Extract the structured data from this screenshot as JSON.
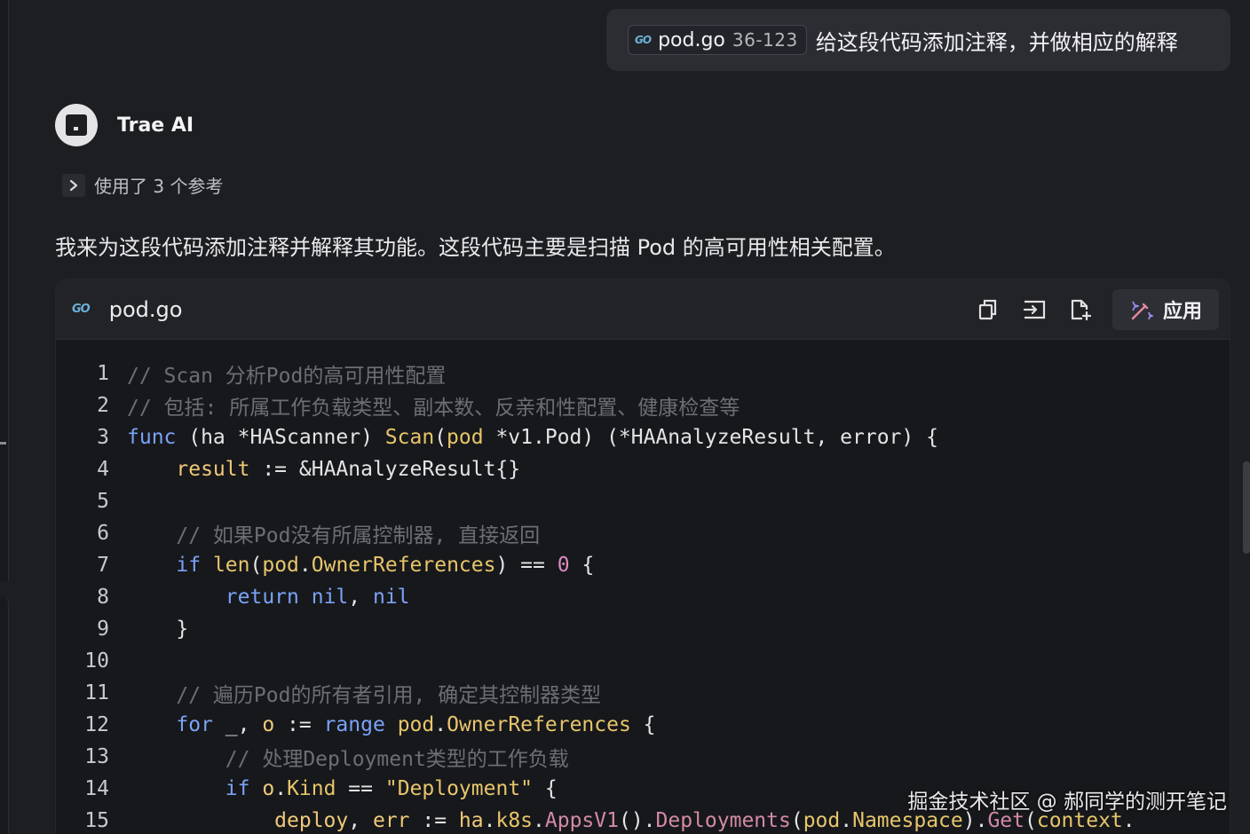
{
  "user_message": {
    "file_chip": {
      "icon": "go-file-icon",
      "icon_text": "GO",
      "name": "pod.go",
      "range": "36-123"
    },
    "text": "给这段代码添加注释，并做相应的解释"
  },
  "assistant": {
    "name": "Trae AI",
    "refs_label": "使用了 3 个参考",
    "intro": "我来为这段代码添加注释并解释其功能。这段代码主要是扫描 Pod 的高可用性相关配置。"
  },
  "code_block": {
    "filename": "pod.go",
    "icon_text": "GO",
    "toolbar": {
      "copy": "copy-icon",
      "insert": "insert-icon",
      "new_file": "new-file-icon",
      "apply_icon": "magic-wand-icon",
      "apply_label": "应用"
    },
    "lines": [
      {
        "n": "1",
        "tokens": [
          [
            "c-com",
            "// Scan 分析Pod的高可用性配置"
          ]
        ]
      },
      {
        "n": "2",
        "tokens": [
          [
            "c-com",
            "// 包括: 所属工作负载类型、副本数、反亲和性配置、健康检查等"
          ]
        ]
      },
      {
        "n": "3",
        "tokens": [
          [
            "c-kw",
            "func"
          ],
          [
            "c-id",
            " (ha *HAScanner) "
          ],
          [
            "c-fn",
            "Scan"
          ],
          [
            "c-id",
            "("
          ],
          [
            "c-par",
            "pod"
          ],
          [
            "c-id",
            " *v1.Pod) (*HAAnalyzeResult, error) {"
          ]
        ]
      },
      {
        "n": "4",
        "tokens": [
          [
            "c-id",
            "    "
          ],
          [
            "c-vr",
            "result"
          ],
          [
            "c-id",
            " := &HAAnalyzeResult{}"
          ]
        ]
      },
      {
        "n": "5",
        "tokens": []
      },
      {
        "n": "6",
        "tokens": [
          [
            "c-id",
            "    "
          ],
          [
            "c-com",
            "// 如果Pod没有所属控制器, 直接返回"
          ]
        ]
      },
      {
        "n": "7",
        "tokens": [
          [
            "c-id",
            "    "
          ],
          [
            "c-kw",
            "if"
          ],
          [
            "c-id",
            " "
          ],
          [
            "c-fn",
            "len"
          ],
          [
            "c-id",
            "("
          ],
          [
            "c-par",
            "pod"
          ],
          [
            "c-id",
            "."
          ],
          [
            "c-fn",
            "OwnerReferences"
          ],
          [
            "c-id",
            ") == "
          ],
          [
            "c-num",
            "0"
          ],
          [
            "c-id",
            " {"
          ]
        ]
      },
      {
        "n": "8",
        "tokens": [
          [
            "c-id",
            "        "
          ],
          [
            "c-kw",
            "return"
          ],
          [
            "c-id",
            " "
          ],
          [
            "c-kw",
            "nil"
          ],
          [
            "c-id",
            ", "
          ],
          [
            "c-kw",
            "nil"
          ]
        ]
      },
      {
        "n": "9",
        "tokens": [
          [
            "c-id",
            "    }"
          ]
        ]
      },
      {
        "n": "10",
        "tokens": []
      },
      {
        "n": "11",
        "tokens": [
          [
            "c-id",
            "    "
          ],
          [
            "c-com",
            "// 遍历Pod的所有者引用, 确定其控制器类型"
          ]
        ]
      },
      {
        "n": "12",
        "tokens": [
          [
            "c-id",
            "    "
          ],
          [
            "c-kw",
            "for"
          ],
          [
            "c-id",
            " _, "
          ],
          [
            "c-vr",
            "o"
          ],
          [
            "c-id",
            " := "
          ],
          [
            "c-kw",
            "range"
          ],
          [
            "c-id",
            " "
          ],
          [
            "c-par",
            "pod"
          ],
          [
            "c-id",
            "."
          ],
          [
            "c-fn",
            "OwnerReferences"
          ],
          [
            "c-id",
            " {"
          ]
        ]
      },
      {
        "n": "13",
        "tokens": [
          [
            "c-id",
            "        "
          ],
          [
            "c-com",
            "// 处理Deployment类型的工作负载"
          ]
        ]
      },
      {
        "n": "14",
        "tokens": [
          [
            "c-id",
            "        "
          ],
          [
            "c-kw",
            "if"
          ],
          [
            "c-id",
            " "
          ],
          [
            "c-vr",
            "o"
          ],
          [
            "c-id",
            "."
          ],
          [
            "c-fn",
            "Kind"
          ],
          [
            "c-id",
            " == "
          ],
          [
            "c-str",
            "\"Deployment\""
          ],
          [
            "c-id",
            " {"
          ]
        ]
      },
      {
        "n": "15",
        "tokens": [
          [
            "c-id",
            "            "
          ],
          [
            "c-vr",
            "deploy"
          ],
          [
            "c-id",
            ", "
          ],
          [
            "c-vr",
            "err"
          ],
          [
            "c-id",
            " := "
          ],
          [
            "c-vr",
            "ha"
          ],
          [
            "c-id",
            "."
          ],
          [
            "c-fn",
            "k8s"
          ],
          [
            "c-id",
            "."
          ],
          [
            "c-mth",
            "AppsV1"
          ],
          [
            "c-id",
            "()."
          ],
          [
            "c-mth",
            "Deployments"
          ],
          [
            "c-id",
            "("
          ],
          [
            "c-par",
            "pod"
          ],
          [
            "c-id",
            "."
          ],
          [
            "c-fn",
            "Namespace"
          ],
          [
            "c-id",
            ")."
          ],
          [
            "c-mth",
            "Get"
          ],
          [
            "c-id",
            "("
          ],
          [
            "c-par",
            "context"
          ],
          [
            "c-id",
            "."
          ]
        ]
      }
    ]
  },
  "watermark": "掘金技术社区 @ 郝同学的测开笔记"
}
